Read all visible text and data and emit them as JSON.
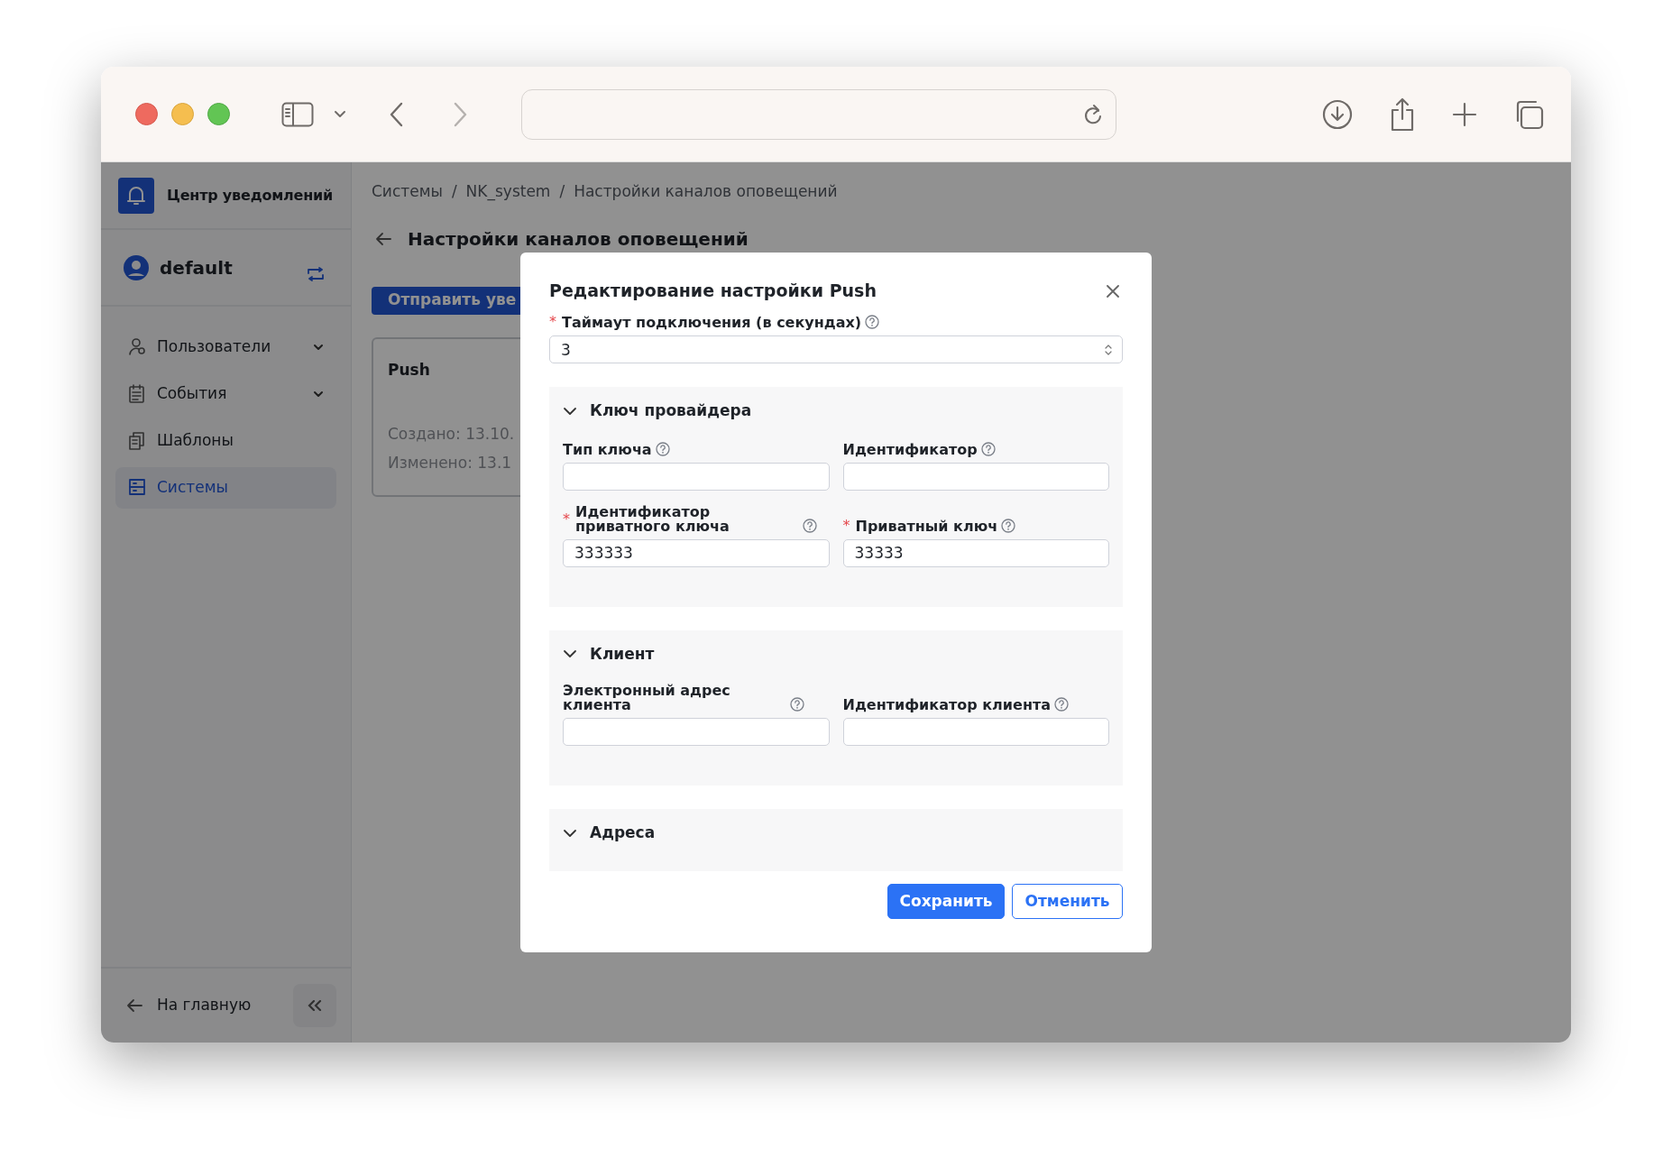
{
  "sidebar": {
    "title": "Центр уведомлений",
    "user": "default",
    "items": [
      {
        "label": "Пользователи",
        "expandable": true,
        "selected": false
      },
      {
        "label": "События",
        "expandable": true,
        "selected": false
      },
      {
        "label": "Шаблоны",
        "expandable": false,
        "selected": false
      },
      {
        "label": "Системы",
        "expandable": false,
        "selected": true
      }
    ],
    "footer_link": "На главную"
  },
  "breadcrumbs": {
    "separator": "/",
    "items": [
      "Системы",
      "NK_system",
      "Настройки каналов оповещений"
    ]
  },
  "page_title": "Настройки каналов оповещений",
  "primary_action": "Отправить уве",
  "card": {
    "title": "Push",
    "lines": [
      "Создано: 13.10.",
      "Изменено: 13.1"
    ]
  },
  "modal": {
    "title": "Редактирование настройки Push",
    "required_mark": "*",
    "fields": [
      {
        "label": "Таймаут подключения (в секундах)",
        "required": true,
        "help": true,
        "kind": "number",
        "value": "3"
      }
    ],
    "sections": [
      {
        "title": "Ключ провайдера",
        "expanded": true,
        "fields": [
          {
            "label": "Тип ключа",
            "required": false,
            "help": true
          },
          {
            "label": "Идентификатор",
            "required": false,
            "help": true
          },
          {
            "label": "Идентификатор приватного ключа",
            "required": true,
            "help": true,
            "value": "333333"
          },
          {
            "label": "Приватный ключ",
            "required": true,
            "help": true,
            "value": "33333"
          }
        ]
      },
      {
        "title": "Клиент",
        "expanded": true,
        "fields": [
          {
            "label": "Электронный адрес клиента",
            "required": false,
            "help": true
          },
          {
            "label": "Идентификатор клиента",
            "required": false,
            "help": true
          }
        ]
      },
      {
        "title": "Адреса",
        "expanded": true
      }
    ],
    "buttons": [
      {
        "label": "Сохранить",
        "kind": "primary"
      },
      {
        "label": "Отменить",
        "kind": "outline"
      }
    ]
  }
}
